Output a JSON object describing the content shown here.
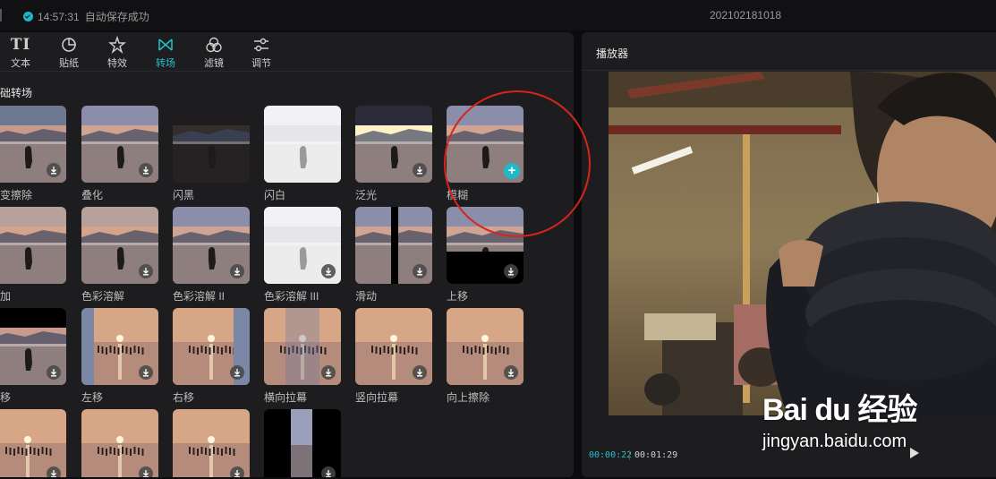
{
  "status_bar": {
    "save_time": "14:57:31",
    "save_text": "自动保存成功",
    "project_name": "202102181018"
  },
  "toolbar": {
    "tabs": [
      {
        "label": "文本",
        "icon": "text-icon"
      },
      {
        "label": "贴纸",
        "icon": "sticker-icon"
      },
      {
        "label": "特效",
        "icon": "effects-icon"
      },
      {
        "label": "转场",
        "icon": "transition-icon",
        "active": true
      },
      {
        "label": "滤镜",
        "icon": "filter-icon"
      },
      {
        "label": "调节",
        "icon": "adjust-icon"
      }
    ],
    "text_icon_glyph": "TI"
  },
  "transitions": {
    "section_title": "础转场",
    "items": [
      {
        "label": "新变擦除",
        "state": "download"
      },
      {
        "label": "叠化",
        "state": "download"
      },
      {
        "label": "闪黑",
        "state": "none"
      },
      {
        "label": "闪白",
        "state": "none"
      },
      {
        "label": "泛光",
        "state": "download"
      },
      {
        "label": "模糊",
        "state": "add"
      },
      {
        "label": "叠加",
        "state": "none"
      },
      {
        "label": "色彩溶解",
        "state": "download"
      },
      {
        "label": "色彩溶解 II",
        "state": "download"
      },
      {
        "label": "色彩溶解 III",
        "state": "download"
      },
      {
        "label": "滑动",
        "state": "download"
      },
      {
        "label": "上移",
        "state": "download"
      },
      {
        "label": "下移",
        "state": "download"
      },
      {
        "label": "左移",
        "state": "download"
      },
      {
        "label": "右移",
        "state": "download"
      },
      {
        "label": "横向拉幕",
        "state": "download"
      },
      {
        "label": "竖向拉幕",
        "state": "download"
      },
      {
        "label": "向上擦除",
        "state": "download"
      },
      {
        "label": "",
        "state": "download"
      },
      {
        "label": "",
        "state": "download"
      },
      {
        "label": "",
        "state": "download"
      },
      {
        "label": "",
        "state": "download"
      }
    ]
  },
  "player": {
    "title": "播放器",
    "current_time": "00:00:22",
    "total_time": "00:01:29"
  },
  "watermark": {
    "brand": "Bai du 经验",
    "url": "jingyan.baidu.com"
  },
  "colors": {
    "accent": "#23c1cf",
    "annotation": "#d9241c",
    "panel": "#1d1d20",
    "background": "#0c0c0e"
  }
}
